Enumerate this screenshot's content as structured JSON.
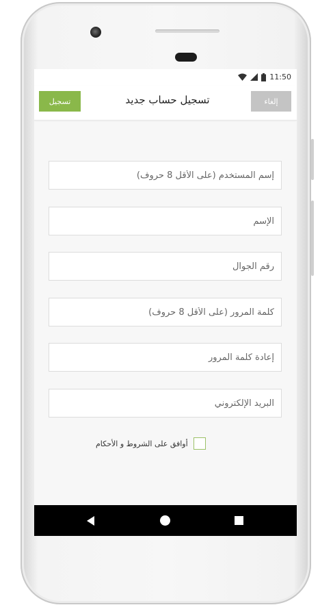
{
  "status_bar": {
    "time": "11:50"
  },
  "toolbar": {
    "register_label": "تسجيل",
    "title": "تسجيل حساب جديد",
    "cancel_label": "إلغاء"
  },
  "form": {
    "fields": [
      {
        "placeholder": "إسم المستخدم (على الأقل 8 حروف)"
      },
      {
        "placeholder": "الإسم"
      },
      {
        "placeholder": "رقم الجوال"
      },
      {
        "placeholder": "كلمة المرور (على الأقل 8 حروف)"
      },
      {
        "placeholder": "إعادة كلمة المرور"
      },
      {
        "placeholder": "البريد الإلكتروني"
      }
    ],
    "terms_label": "أوافق على الشروط و الأحكام"
  },
  "colors": {
    "accent": "#8ab84a",
    "cancel": "#c4c4c4",
    "navbar": "#000000"
  }
}
